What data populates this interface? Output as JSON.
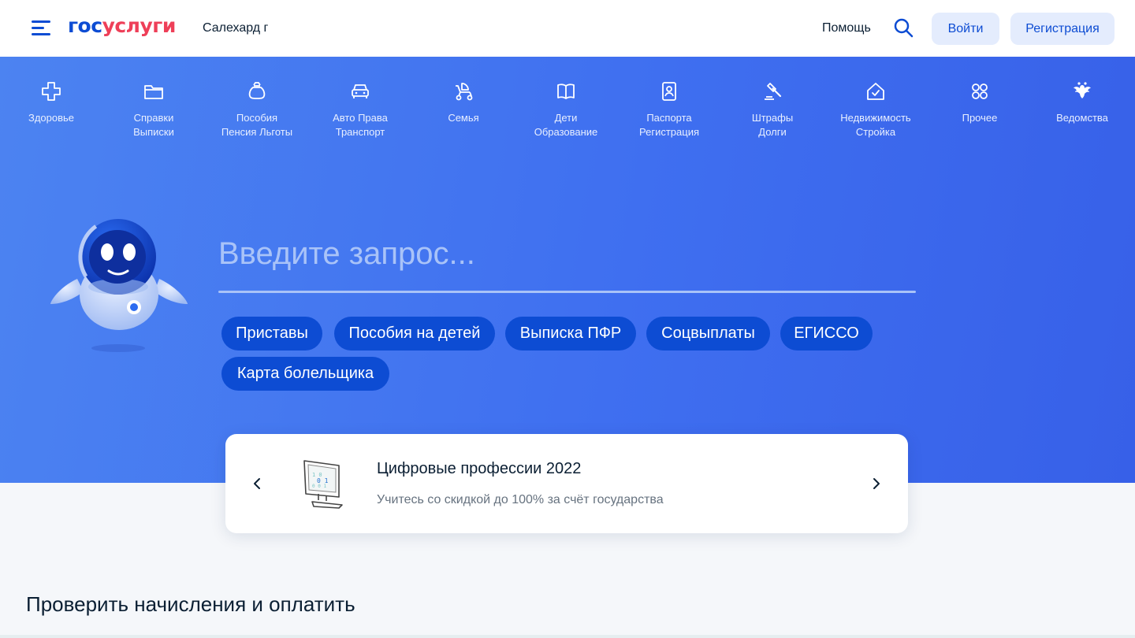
{
  "header": {
    "logo_part1": "гос",
    "logo_part2": "услуги",
    "city": "Салехард г",
    "help": "Помощь",
    "login": "Войти",
    "register": "Регистрация"
  },
  "categories": [
    {
      "label": "Здоровье",
      "icon": "plus-cross-icon"
    },
    {
      "label": "Справки\nВыписки",
      "icon": "folder-icon"
    },
    {
      "label": "Пособия\nПенсия Льготы",
      "icon": "money-bag-icon"
    },
    {
      "label": "Авто Права\nТранспорт",
      "icon": "car-icon"
    },
    {
      "label": "Семья",
      "icon": "baby-stroller-icon"
    },
    {
      "label": "Дети\nОбразование",
      "icon": "book-icon"
    },
    {
      "label": "Паспорта\nРегистрация",
      "icon": "passport-icon"
    },
    {
      "label": "Штрафы\nДолги",
      "icon": "gavel-icon"
    },
    {
      "label": "Недвижимость\nСтройка",
      "icon": "house-check-icon"
    },
    {
      "label": "Прочее",
      "icon": "grid-icon"
    },
    {
      "label": "Ведомства",
      "icon": "coat-of-arms-icon"
    }
  ],
  "search": {
    "placeholder": "Введите запрос..."
  },
  "chips": [
    "Приставы",
    "Пособия на детей",
    "Выписка ПФР",
    "Соцвыплаты",
    "ЕГИССО",
    "Карта болельщика"
  ],
  "promo": {
    "title": "Цифровые профессии 2022",
    "subtitle": "Учитесь со скидкой до 100% за счёт государства"
  },
  "section_title": "Проверить начисления и оплатить",
  "colors": {
    "brand_blue": "#0d4cd3",
    "brand_red": "#ee3f58",
    "hero_blue": "#4076f0",
    "button_light": "#e4ecfd"
  }
}
